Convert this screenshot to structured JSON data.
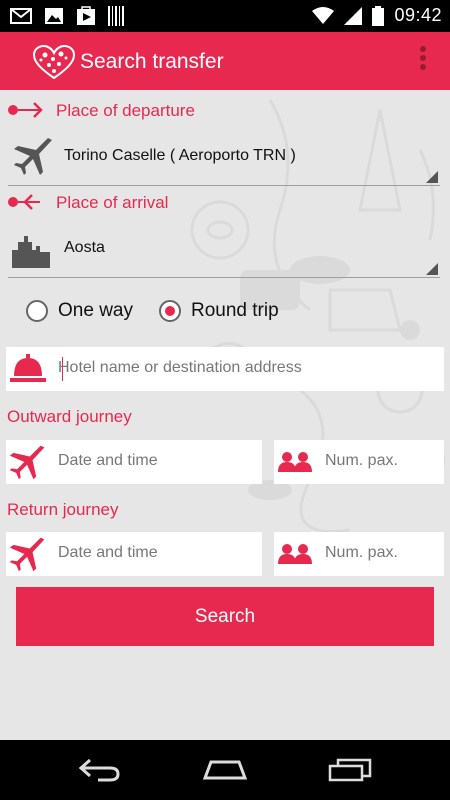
{
  "status_bar": {
    "time": "09:42",
    "icons": [
      "gmail-icon",
      "image-icon",
      "play-store-icon",
      "barcode-icon",
      "wifi-icon",
      "signal-icon",
      "battery-icon"
    ]
  },
  "app_bar": {
    "title": "Search transfer",
    "logo_icon": "heart-logo-icon",
    "overflow_icon": "overflow-menu-icon"
  },
  "departure": {
    "label": "Place of departure",
    "value": "Torino Caselle ( Aeroporto TRN )",
    "icon": "airplane-icon"
  },
  "arrival": {
    "label": "Place of arrival",
    "value": "Aosta",
    "icon": "city-icon"
  },
  "trip_type": {
    "options": [
      "One way",
      "Round trip"
    ],
    "selected": "Round trip"
  },
  "hotel": {
    "placeholder": "Hotel name or destination address",
    "icon": "bell-icon"
  },
  "outward": {
    "label": "Outward journey",
    "date_placeholder": "Date and time",
    "pax_placeholder": "Num. pax."
  },
  "return": {
    "label": "Return journey",
    "date_placeholder": "Date and time",
    "pax_placeholder": "Num. pax."
  },
  "search_button": "Search",
  "nav_bar": {
    "icons": [
      "back-icon",
      "home-icon",
      "recent-apps-icon"
    ]
  },
  "colors": {
    "accent": "#e8294f",
    "background": "#e6e6e6"
  }
}
